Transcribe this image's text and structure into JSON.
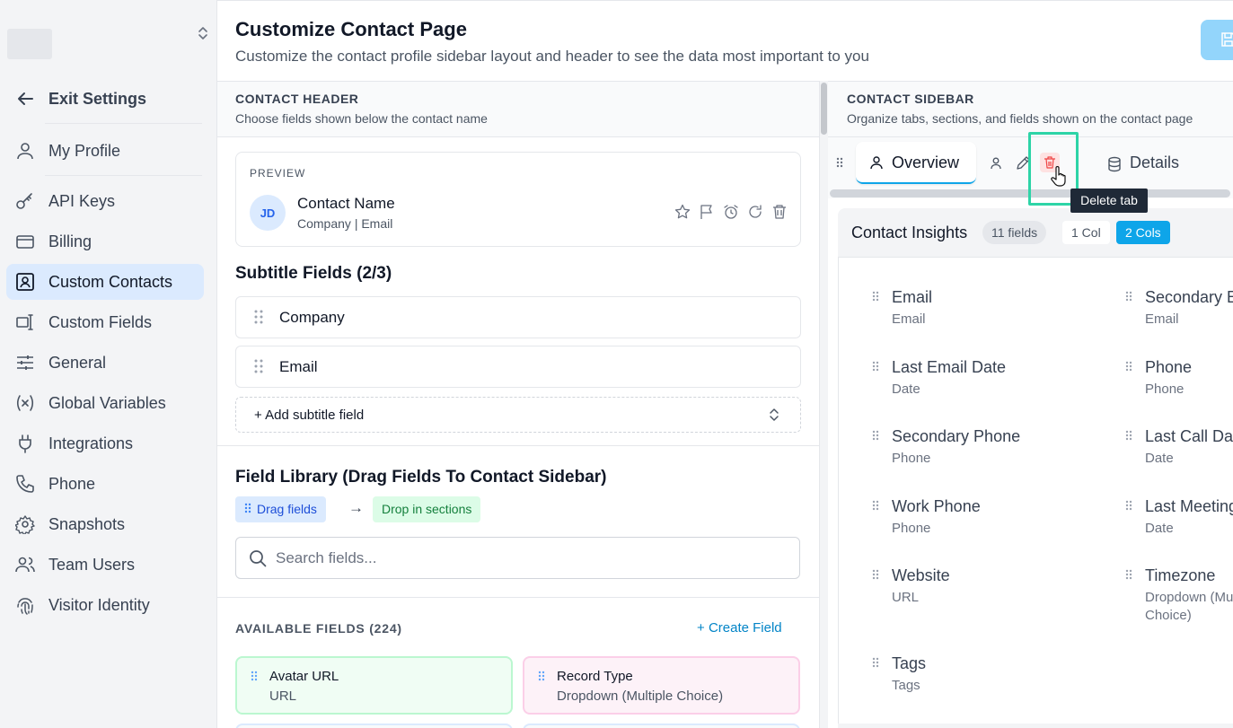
{
  "sidebar": {
    "exit_label": "Exit Settings",
    "items": [
      {
        "label": "My Profile",
        "icon": "user-icon"
      },
      {
        "label": "API Keys",
        "icon": "key-icon"
      },
      {
        "label": "Billing",
        "icon": "credit-card-icon"
      },
      {
        "label": "Custom Contacts",
        "icon": "contact-card-icon",
        "active": true
      },
      {
        "label": "Custom Fields",
        "icon": "text-cursor-icon"
      },
      {
        "label": "General",
        "icon": "sliders-icon"
      },
      {
        "label": "Global Variables",
        "icon": "variable-icon"
      },
      {
        "label": "Integrations",
        "icon": "plug-icon"
      },
      {
        "label": "Phone",
        "icon": "phone-icon"
      },
      {
        "label": "Snapshots",
        "icon": "gear-icon"
      },
      {
        "label": "Team Users",
        "icon": "users-icon"
      },
      {
        "label": "Visitor Identity",
        "icon": "fingerprint-icon"
      }
    ]
  },
  "header": {
    "title": "Customize Contact Page",
    "subtitle": "Customize the contact profile sidebar layout and header to see the data most important to you"
  },
  "contact_header": {
    "title": "CONTACT HEADER",
    "subtitle": "Choose fields shown below the contact name",
    "preview": {
      "label": "PREVIEW",
      "initials": "JD",
      "name": "Contact Name",
      "company": "Company",
      "separator": "|",
      "email": "Email"
    },
    "subtitle_fields_title": "Subtitle Fields (2/3)",
    "subtitle_fields": [
      "Company",
      "Email"
    ],
    "add_subtitle_label": "+ Add subtitle field"
  },
  "field_library": {
    "title": "Field Library (Drag Fields To Contact Sidebar)",
    "drag_chip": "Drag fields",
    "arrow": "→",
    "drop_chip": "Drop in sections",
    "search_placeholder": "Search fields...",
    "available_title": "AVAILABLE FIELDS (224)",
    "create_label": "Create Field",
    "cards": [
      {
        "name": "Avatar URL",
        "type": "URL",
        "color": "#f0fdf4"
      },
      {
        "name": "Record Type",
        "type": "Dropdown (Multiple Choice)",
        "color": "#fdf2f8"
      }
    ]
  },
  "contact_sidebar": {
    "title": "CONTACT SIDEBAR",
    "subtitle": "Organize tabs, sections, and fields shown on the contact page",
    "tabs": [
      {
        "label": "Overview",
        "active": true
      },
      {
        "label": "Details"
      }
    ],
    "tooltip": "Delete tab",
    "section": {
      "title": "Contact Insights",
      "count": "11 fields",
      "col1": "1 Col",
      "col2": "2 Cols"
    },
    "fields_left": [
      {
        "name": "Email",
        "type": "Email"
      },
      {
        "name": "Last Email Date",
        "type": "Date"
      },
      {
        "name": "Secondary Phone",
        "type": "Phone"
      },
      {
        "name": "Work Phone",
        "type": "Phone"
      },
      {
        "name": "Website",
        "type": "URL"
      },
      {
        "name": "Tags",
        "type": "Tags"
      }
    ],
    "fields_right": [
      {
        "name": "Secondary Email",
        "type": "Email"
      },
      {
        "name": "Phone",
        "type": "Phone"
      },
      {
        "name": "Last Call Date",
        "type": "Date"
      },
      {
        "name": "Last Meeting Date",
        "type": "Date"
      },
      {
        "name": "Timezone",
        "type": "Dropdown (Multiple",
        "type2": "Choice)"
      }
    ]
  }
}
